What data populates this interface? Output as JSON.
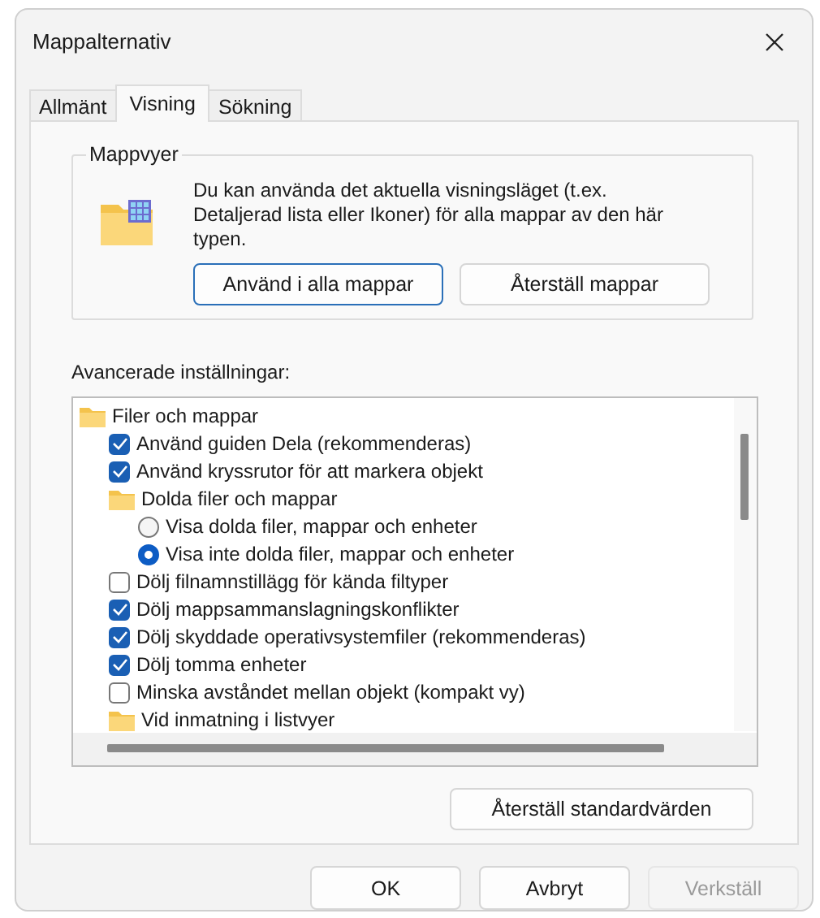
{
  "window": {
    "title": "Mappalternativ"
  },
  "tabs": [
    {
      "label": "Allmänt",
      "selected": false
    },
    {
      "label": "Visning",
      "selected": true
    },
    {
      "label": "Sökning",
      "selected": false
    }
  ],
  "folder_views": {
    "title": "Mappvyer",
    "description": "Du kan använda det aktuella visningsläget (t.ex. Detaljerad lista eller Ikoner) för alla mappar av den här typen.",
    "buttons": [
      {
        "label": "Använd i alla mappar",
        "focused": true
      },
      {
        "label": "Återställ mappar",
        "focused": false
      }
    ]
  },
  "advanced": {
    "label": "Avancerade inställningar:",
    "items": [
      {
        "kind": "folder",
        "label": "Filer och mappar",
        "children": [
          {
            "kind": "checkbox",
            "label": "Använd guiden Dela (rekommenderas)",
            "checked": true
          },
          {
            "kind": "checkbox",
            "label": "Använd kryssrutor för att markera objekt",
            "checked": true
          },
          {
            "kind": "folder",
            "label": "Dolda filer och mappar",
            "children": [
              {
                "kind": "radio",
                "label": "Visa dolda filer, mappar och enheter",
                "selected": false
              },
              {
                "kind": "radio",
                "label": "Visa inte dolda filer, mappar och enheter",
                "selected": true
              }
            ]
          },
          {
            "kind": "checkbox",
            "label": "Dölj filnamnstillägg för kända filtyper",
            "checked": false
          },
          {
            "kind": "checkbox",
            "label": "Dölj mappsammanslagningskonflikter",
            "checked": true
          },
          {
            "kind": "checkbox",
            "label": "Dölj skyddade operativsystemfiler (rekommenderas)",
            "checked": true
          },
          {
            "kind": "checkbox",
            "label": "Dölj tomma enheter",
            "checked": true
          },
          {
            "kind": "checkbox",
            "label": "Minska avståndet mellan objekt (kompakt vy)",
            "checked": false
          },
          {
            "kind": "folder",
            "label": "Vid inmatning i listvyer"
          }
        ]
      }
    ],
    "reset_button": "Återställ standardvärden"
  },
  "buttons": [
    {
      "label": "OK",
      "disabled": false
    },
    {
      "label": "Avbryt",
      "disabled": false
    },
    {
      "label": "Verkställ",
      "disabled": true
    }
  ]
}
